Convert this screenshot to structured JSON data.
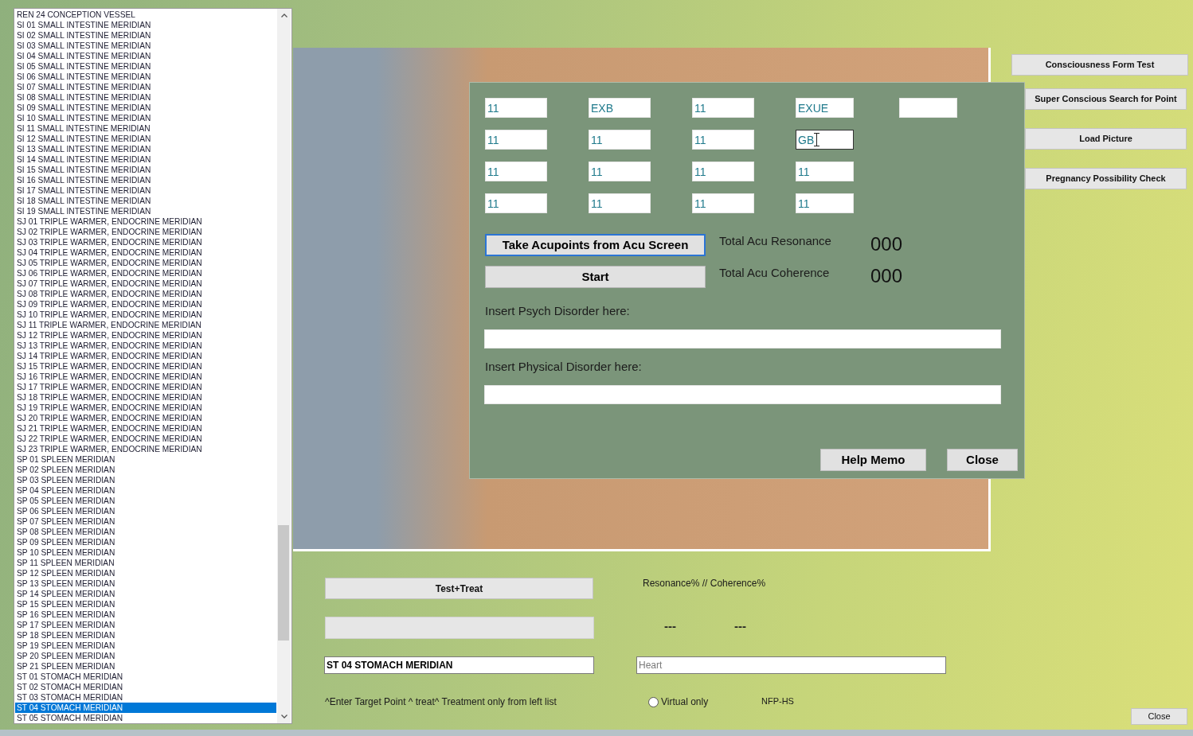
{
  "meridian_list": {
    "items": [
      {
        "label": "REN 24 CONCEPTION VESSEL",
        "selected": false
      },
      {
        "label": "SI 01 SMALL INTESTINE MERIDIAN",
        "selected": false
      },
      {
        "label": "SI 02 SMALL INTESTINE MERIDIAN",
        "selected": false
      },
      {
        "label": "SI 03 SMALL INTESTINE MERIDIAN",
        "selected": false
      },
      {
        "label": "SI 04 SMALL INTESTINE MERIDIAN",
        "selected": false
      },
      {
        "label": "SI 05 SMALL INTESTINE MERIDIAN",
        "selected": false
      },
      {
        "label": "SI 06 SMALL INTESTINE MERIDIAN",
        "selected": false
      },
      {
        "label": "SI 07 SMALL INTESTINE MERIDIAN",
        "selected": false
      },
      {
        "label": "SI 08 SMALL INTESTINE MERIDIAN",
        "selected": false
      },
      {
        "label": "SI 09 SMALL INTESTINE MERIDIAN",
        "selected": false
      },
      {
        "label": "SI 10 SMALL INTESTINE MERIDIAN",
        "selected": false
      },
      {
        "label": "SI 11 SMALL INTESTINE MERIDIAN",
        "selected": false
      },
      {
        "label": "SI 12 SMALL INTESTINE MERIDIAN",
        "selected": false
      },
      {
        "label": "SI 13 SMALL INTESTINE MERIDIAN",
        "selected": false
      },
      {
        "label": "SI 14 SMALL INTESTINE MERIDIAN",
        "selected": false
      },
      {
        "label": "SI 15 SMALL INTESTINE MERIDIAN",
        "selected": false
      },
      {
        "label": "SI 16 SMALL INTESTINE MERIDIAN",
        "selected": false
      },
      {
        "label": "SI 17 SMALL INTESTINE MERIDIAN",
        "selected": false
      },
      {
        "label": "SI 18 SMALL INTESTINE MERIDIAN",
        "selected": false
      },
      {
        "label": "SI 19 SMALL INTESTINE MERIDIAN",
        "selected": false
      },
      {
        "label": "SJ 01 TRIPLE WARMER, ENDOCRINE MERIDIAN",
        "selected": false
      },
      {
        "label": "SJ 02 TRIPLE WARMER, ENDOCRINE MERIDIAN",
        "selected": false
      },
      {
        "label": "SJ 03 TRIPLE WARMER, ENDOCRINE MERIDIAN",
        "selected": false
      },
      {
        "label": "SJ 04 TRIPLE WARMER, ENDOCRINE MERIDIAN",
        "selected": false
      },
      {
        "label": "SJ 05 TRIPLE WARMER, ENDOCRINE MERIDIAN",
        "selected": false
      },
      {
        "label": "SJ 06 TRIPLE WARMER, ENDOCRINE MERIDIAN",
        "selected": false
      },
      {
        "label": "SJ 07 TRIPLE WARMER, ENDOCRINE MERIDIAN",
        "selected": false
      },
      {
        "label": "SJ 08 TRIPLE WARMER, ENDOCRINE MERIDIAN",
        "selected": false
      },
      {
        "label": "SJ 09 TRIPLE WARMER, ENDOCRINE MERIDIAN",
        "selected": false
      },
      {
        "label": "SJ 10 TRIPLE WARMER, ENDOCRINE MERIDIAN",
        "selected": false
      },
      {
        "label": "SJ 11 TRIPLE WARMER, ENDOCRINE MERIDIAN",
        "selected": false
      },
      {
        "label": "SJ 12 TRIPLE WARMER, ENDOCRINE MERIDIAN",
        "selected": false
      },
      {
        "label": "SJ 13 TRIPLE WARMER, ENDOCRINE MERIDIAN",
        "selected": false
      },
      {
        "label": "SJ 14 TRIPLE WARMER, ENDOCRINE MERIDIAN",
        "selected": false
      },
      {
        "label": "SJ 15 TRIPLE WARMER, ENDOCRINE MERIDIAN",
        "selected": false
      },
      {
        "label": "SJ 16 TRIPLE WARMER, ENDOCRINE MERIDIAN",
        "selected": false
      },
      {
        "label": "SJ 17 TRIPLE WARMER, ENDOCRINE MERIDIAN",
        "selected": false
      },
      {
        "label": "SJ 18 TRIPLE WARMER, ENDOCRINE MERIDIAN",
        "selected": false
      },
      {
        "label": "SJ 19 TRIPLE WARMER, ENDOCRINE MERIDIAN",
        "selected": false
      },
      {
        "label": "SJ 20 TRIPLE WARMER, ENDOCRINE MERIDIAN",
        "selected": false
      },
      {
        "label": "SJ 21 TRIPLE WARMER, ENDOCRINE MERIDIAN",
        "selected": false
      },
      {
        "label": "SJ 22 TRIPLE WARMER, ENDOCRINE MERIDIAN",
        "selected": false
      },
      {
        "label": "SJ 23 TRIPLE WARMER, ENDOCRINE MERIDIAN",
        "selected": false
      },
      {
        "label": "SP 01 SPLEEN MERIDIAN",
        "selected": false
      },
      {
        "label": "SP 02 SPLEEN MERIDIAN",
        "selected": false
      },
      {
        "label": "SP 03 SPLEEN MERIDIAN",
        "selected": false
      },
      {
        "label": "SP 04 SPLEEN MERIDIAN",
        "selected": false
      },
      {
        "label": "SP 05 SPLEEN MERIDIAN",
        "selected": false
      },
      {
        "label": "SP 06 SPLEEN MERIDIAN",
        "selected": false
      },
      {
        "label": "SP 07 SPLEEN MERIDIAN",
        "selected": false
      },
      {
        "label": "SP 08 SPLEEN MERIDIAN",
        "selected": false
      },
      {
        "label": "SP 09 SPLEEN MERIDIAN",
        "selected": false
      },
      {
        "label": "SP 10 SPLEEN MERIDIAN",
        "selected": false
      },
      {
        "label": "SP 11 SPLEEN MERIDIAN",
        "selected": false
      },
      {
        "label": "SP 12 SPLEEN MERIDIAN",
        "selected": false
      },
      {
        "label": "SP 13 SPLEEN MERIDIAN",
        "selected": false
      },
      {
        "label": "SP 14 SPLEEN MERIDIAN",
        "selected": false
      },
      {
        "label": "SP 15 SPLEEN MERIDIAN",
        "selected": false
      },
      {
        "label": "SP 16 SPLEEN MERIDIAN",
        "selected": false
      },
      {
        "label": "SP 17 SPLEEN MERIDIAN",
        "selected": false
      },
      {
        "label": "SP 18 SPLEEN MERIDIAN",
        "selected": false
      },
      {
        "label": "SP 19 SPLEEN MERIDIAN",
        "selected": false
      },
      {
        "label": "SP 20 SPLEEN MERIDIAN",
        "selected": false
      },
      {
        "label": "SP 21 SPLEEN MERIDIAN",
        "selected": false
      },
      {
        "label": "ST 01 STOMACH MERIDIAN",
        "selected": false
      },
      {
        "label": "ST 02 STOMACH MERIDIAN",
        "selected": false
      },
      {
        "label": "ST 03 STOMACH MERIDIAN",
        "selected": false
      },
      {
        "label": "ST 04 STOMACH MERIDIAN",
        "selected": true
      },
      {
        "label": "ST 05 STOMACH MERIDIAN",
        "selected": false
      }
    ]
  },
  "acupoint_dialog": {
    "point_rows": [
      {
        "fields": [
          {
            "value": "11",
            "focused": false
          },
          {
            "value": "EXB",
            "focused": false
          },
          {
            "value": "11",
            "focused": false
          },
          {
            "value": "EXUE",
            "focused": false
          },
          {
            "focused": false
          }
        ]
      },
      {
        "fields": [
          {
            "value": "11",
            "focused": false
          },
          {
            "value": "11",
            "focused": false
          },
          {
            "value": "11",
            "focused": false
          },
          {
            "value": "GB",
            "focused": true
          }
        ]
      },
      {
        "fields": [
          {
            "value": "11",
            "focused": false
          },
          {
            "value": "11",
            "focused": false
          },
          {
            "value": "11",
            "focused": false
          },
          {
            "value": "11",
            "focused": false
          }
        ]
      },
      {
        "fields": [
          {
            "value": "11",
            "focused": false
          },
          {
            "value": "11",
            "focused": false
          },
          {
            "value": "11",
            "focused": false
          },
          {
            "value": "11",
            "focused": false
          }
        ]
      }
    ],
    "action_buttons": [
      {
        "label": "Take Acupoints from Acu Screen",
        "focused": true
      },
      {
        "label": "Start",
        "focused": false
      }
    ],
    "totals": [
      {
        "label": "Total Acu Resonance",
        "value": "000"
      },
      {
        "label": "Total Acu Coherence",
        "value": "000"
      }
    ],
    "disorders": [
      {
        "label": "Insert Psych Disorder here:"
      },
      {
        "label": "Insert Physical Disorder here:"
      }
    ],
    "buttons": [
      "Help Memo",
      "Close"
    ]
  },
  "side_buttons": [
    "Consciousness Form Test",
    "Super Conscious Search for Point",
    "Load Picture",
    "Pregnancy Possibility Check"
  ],
  "treatment": {
    "test_treat_button": "Test+Treat",
    "readings_header": "Resonance% // Coherence%",
    "readings": [
      "---",
      "---"
    ],
    "target_point": {
      "value": "ST 04 STOMACH MERIDIAN"
    },
    "organ_field": {
      "placeholder": "Heart"
    },
    "hint": "^Enter Target Point ^ treat^ Treatment only from left list",
    "virtual_only": {
      "label": "Virtual only",
      "checked": false
    },
    "mode_label": "NFP-HS",
    "close_button": "Close"
  }
}
